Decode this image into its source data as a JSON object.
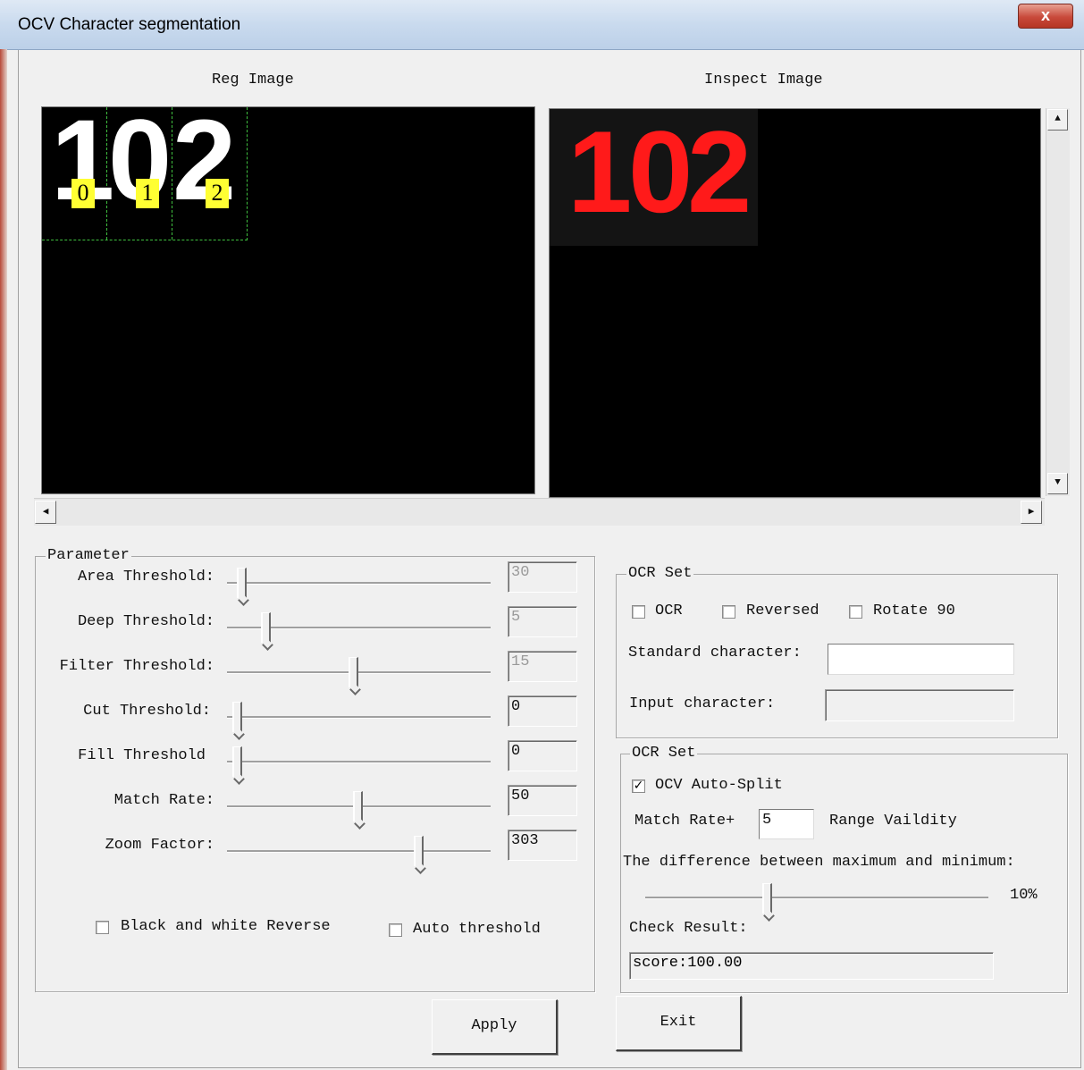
{
  "window": {
    "title": "OCV Character segmentation",
    "close_label": "x"
  },
  "images": {
    "reg_label": "Reg Image",
    "inspect_label": "Inspect Image",
    "reg_digits": [
      "1",
      "0",
      "2"
    ],
    "reg_index_tags": [
      "0",
      "1",
      "2"
    ],
    "inspect_digits": [
      "1",
      "0",
      "2"
    ],
    "inspect_digit_color": "#ff1a1a"
  },
  "parameter": {
    "title": "Parameter",
    "rows": [
      {
        "label": "Area Threshold:",
        "value": "30",
        "disabled": true,
        "level": 0.02
      },
      {
        "label": "Deep Threshold:",
        "value": "5",
        "disabled": true,
        "level": 0.12
      },
      {
        "label": "Filter Threshold:",
        "value": "15",
        "disabled": true,
        "level": 0.48
      },
      {
        "label": "Cut Threshold:",
        "value": "0",
        "disabled": false,
        "level": 0.0
      },
      {
        "label": "Fill Threshold",
        "value": "0",
        "disabled": false,
        "level": 0.0
      },
      {
        "label": "Match Rate:",
        "value": "50",
        "disabled": false,
        "level": 0.5
      },
      {
        "label": "Zoom Factor:",
        "value": "303",
        "disabled": false,
        "level": 0.75
      }
    ],
    "bw_reverse": {
      "label": "Black and white Reverse",
      "checked": false
    },
    "auto_threshold": {
      "label": "Auto threshold",
      "checked": false
    }
  },
  "ocr_set": {
    "title": "OCR Set",
    "ocr": {
      "label": "OCR",
      "checked": false
    },
    "reversed": {
      "label": "Reversed",
      "checked": false
    },
    "rotate": {
      "label": "Rotate 90",
      "checked": false
    },
    "standard_label": "Standard character:",
    "standard_value": "",
    "input_label": "Input character:",
    "input_value": ""
  },
  "ocv_set": {
    "title": "OCR Set",
    "auto_split": {
      "label": "OCV Auto-Split",
      "checked": true
    },
    "match_rate_label": "Match Rate+",
    "match_rate_value": "5",
    "range_label": "Range Vaildity",
    "diff_label": "The difference between maximum and minimum:",
    "diff_value": "10%",
    "diff_level": 0.35,
    "check_label": "Check Result:",
    "check_value": "score:100.00"
  },
  "buttons": {
    "apply": "Apply",
    "exit": "Exit"
  },
  "icons": {
    "scroll_up": "▲",
    "scroll_down": "▼",
    "scroll_left": "◀",
    "scroll_right": "▶",
    "check": "✓"
  }
}
